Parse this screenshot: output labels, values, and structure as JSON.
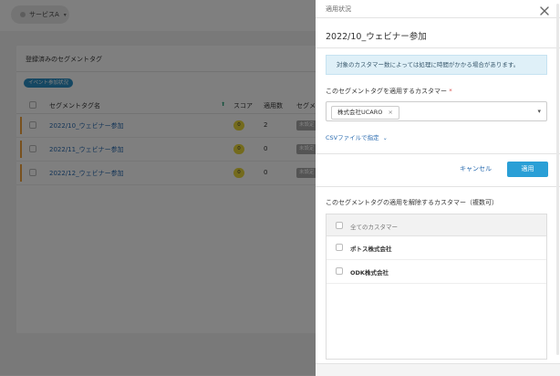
{
  "background": {
    "service_selector": "サービスA",
    "card_title": "登録済みのセグメントタグ",
    "event_badge": "イベント参加状況",
    "columns": [
      "セグメントタグ名",
      "スコア",
      "適用数",
      "セグメ"
    ],
    "rows": [
      {
        "name": "2022/10_ウェビナー参加",
        "score": "0",
        "count": "2",
        "status": "未設定"
      },
      {
        "name": "2022/11_ウェビナー参加",
        "score": "0",
        "count": "0",
        "status": "未設定"
      },
      {
        "name": "2022/12_ウェビナー参加",
        "score": "0",
        "count": "0",
        "status": "未設定"
      }
    ]
  },
  "drawer": {
    "header_label": "適用状況",
    "title": "2022/10_ウェビナー参加",
    "info_message": "対象のカスタマー数によっては処理に時間がかかる場合があります。",
    "apply_label": "このセグメントタグを適用するカスタマー",
    "required_mark": "*",
    "selected_customer": "株式会社UCARO",
    "chip_remove": "×",
    "csv_link": "CSVファイルで指定",
    "cancel_button": "キャンセル",
    "apply_button": "適用",
    "remove_label": "このセグメントタグの適用を解除するカスタマー（複数可）",
    "list_header": "全てのカスタマー",
    "customers": [
      "ポトス株式会社",
      "ODK株式会社"
    ]
  },
  "colors": {
    "accent_blue": "#2a9fd6",
    "link_blue": "#2b6cb0",
    "info_bg": "#dff0f8",
    "row_accent": "#f0a23c",
    "score_yellow": "#e8d63a"
  },
  "icons": {
    "close": "close-icon",
    "chevron": "chevron-down-icon",
    "sort": "sort-up-icon"
  }
}
